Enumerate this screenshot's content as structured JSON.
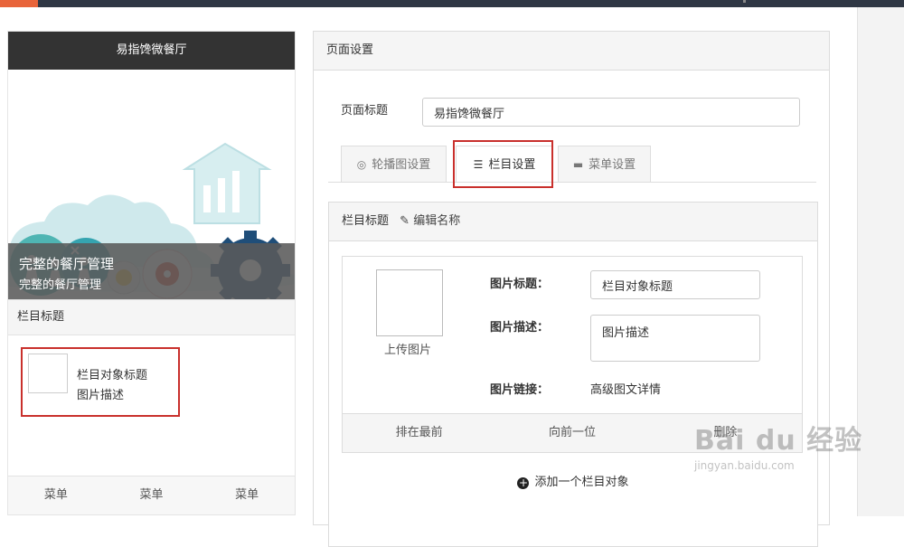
{
  "phone": {
    "header_title": "易指馋微餐厅",
    "banner": {
      "title": "完整的餐厅管理",
      "subtitle": "完整的餐厅管理"
    },
    "section_title": "栏目标题",
    "item": {
      "title": "栏目对象标题",
      "desc": "图片描述"
    },
    "menu": [
      "菜单",
      "菜单",
      "菜单"
    ]
  },
  "settings": {
    "heading": "页面设置",
    "page_title_label": "页面标题",
    "page_title_value": "易指馋微餐厅",
    "tabs": [
      {
        "label": "轮播图设置",
        "icon": "carousel-icon",
        "active": false
      },
      {
        "label": "栏目设置",
        "icon": "list-icon",
        "active": true
      },
      {
        "label": "菜单设置",
        "icon": "menu-icon",
        "active": false
      }
    ],
    "column": {
      "heading_label": "栏目标题",
      "edit_label": "编辑名称",
      "upload_label": "上传图片",
      "img_title_label": "图片标题：",
      "img_title_value": "栏目对象标题",
      "img_desc_label": "图片描述：",
      "img_desc_value": "图片描述",
      "img_link_label": "图片链接：",
      "img_link_value": "高级图文详情",
      "actions": [
        "排在最前",
        "向前一位",
        "删除"
      ],
      "add_label": "添加一个栏目对象"
    }
  },
  "watermark": {
    "line1": "Bai du 经验",
    "line2": "jingyan.baidu.com"
  },
  "colors": {
    "accent": "#e8643a",
    "highlight": "#c9302c",
    "dark": "#333333"
  }
}
